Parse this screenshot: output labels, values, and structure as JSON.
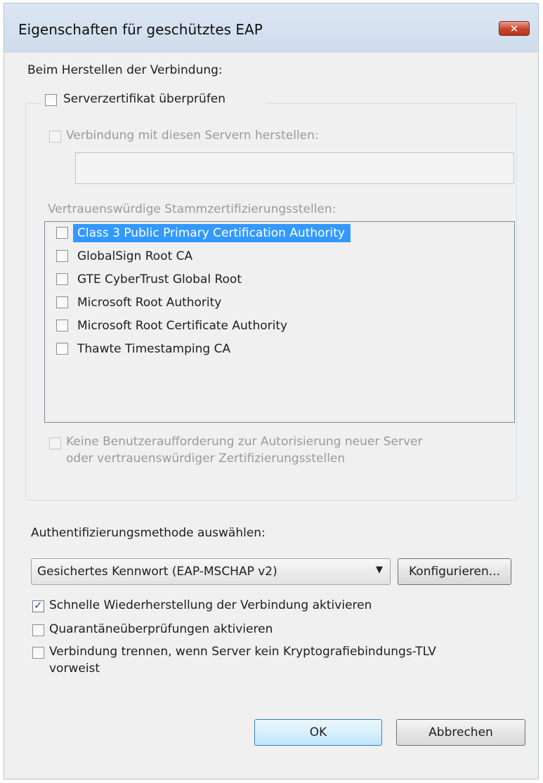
{
  "window": {
    "title": "Eigenschaften für geschütztes EAP",
    "close_label": "✕"
  },
  "connect": {
    "heading": "Beim Herstellen der Verbindung:",
    "validate_cert_label": "Serverzertifikat überprüfen",
    "validate_cert_checked": false,
    "connect_servers_label": "Verbindung mit diesen Servern herstellen:",
    "connect_servers_value": "",
    "trusted_ca_label": "Vertrauenswürdige Stammzertifizierungsstellen:",
    "trusted_ca": [
      {
        "label": "Class 3 Public Primary Certification Authority",
        "checked": false,
        "selected": true
      },
      {
        "label": "GlobalSign Root CA",
        "checked": false,
        "selected": false
      },
      {
        "label": "GTE CyberTrust Global Root",
        "checked": false,
        "selected": false
      },
      {
        "label": "Microsoft Root Authority",
        "checked": false,
        "selected": false
      },
      {
        "label": "Microsoft Root Certificate Authority",
        "checked": false,
        "selected": false
      },
      {
        "label": "Thawte Timestamping CA",
        "checked": false,
        "selected": false
      }
    ],
    "no_prompt_line1": "Keine Benutzeraufforderung zur Autorisierung neuer Server",
    "no_prompt_line2": "oder vertrauenswürdiger Zertifizierungsstellen"
  },
  "auth": {
    "heading": "Authentifizierungsmethode auswählen:",
    "method_value": "Gesichertes Kennwort (EAP-MSCHAP v2)",
    "configure_label": "Konfigurieren...",
    "fast_reconnect_label": "Schnelle Wiederherstellung der Verbindung aktivieren",
    "fast_reconnect_checked": true,
    "quarantine_label": "Quarantäneüberprüfungen aktivieren",
    "quarantine_checked": false,
    "disconnect_line1": "Verbindung trennen, wenn Server kein Kryptografiebindungs-TLV",
    "disconnect_line2": "vorweist",
    "disconnect_checked": false
  },
  "buttons": {
    "ok": "OK",
    "cancel": "Abbrechen"
  }
}
